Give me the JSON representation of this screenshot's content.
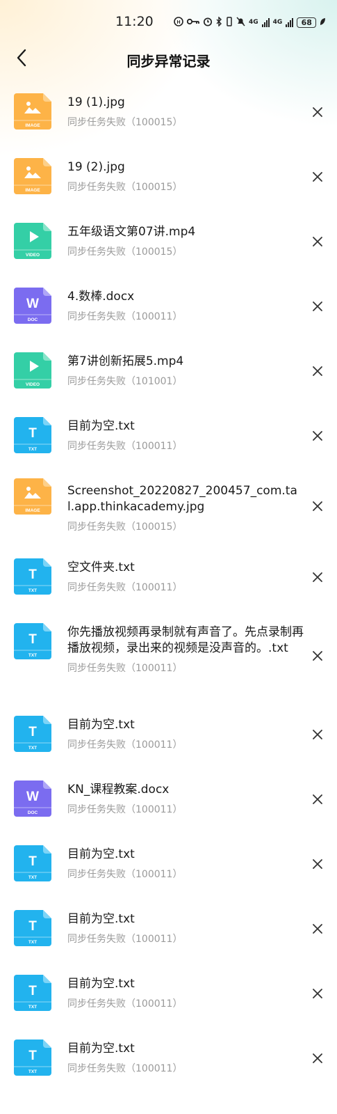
{
  "status_bar": {
    "time": "11:20",
    "net1": "4G",
    "net2": "4G",
    "battery": "68"
  },
  "header": {
    "title": "同步异常记录",
    "back_icon": "chevron-left-icon"
  },
  "icon_types": {
    "IMAGE": {
      "label": "IMAGE",
      "color": "#FDB347",
      "fold": "#FDD08A",
      "glyph": "image"
    },
    "VIDEO": {
      "label": "VIDEO",
      "color": "#34CFA6",
      "fold": "#86E4C9",
      "glyph": "play"
    },
    "DOC": {
      "label": "DOC",
      "color": "#7B6CF0",
      "fold": "#AFA6F7",
      "glyph": "W"
    },
    "TXT": {
      "label": "TXT",
      "color": "#22B3EE",
      "fold": "#7DD4F7",
      "glyph": "T"
    }
  },
  "items": [
    {
      "type": "IMAGE",
      "name": "19 (1).jpg",
      "status": "同步任务失败（100015）"
    },
    {
      "type": "IMAGE",
      "name": "19 (2).jpg",
      "status": "同步任务失败（100015）"
    },
    {
      "type": "VIDEO",
      "name": "五年级语文第07讲.mp4",
      "status": "同步任务失败（100015）"
    },
    {
      "type": "DOC",
      "name": "4.数棒.docx",
      "status": "同步任务失败（100011）"
    },
    {
      "type": "VIDEO",
      "name": "第7讲创新拓展5.mp4",
      "status": "同步任务失败（101001）"
    },
    {
      "type": "TXT",
      "name": "目前为空.txt",
      "status": "同步任务失败（100011）"
    },
    {
      "type": "IMAGE",
      "name": "Screenshot_20220827_200457_com.tal.app.thinkacademy.jpg",
      "status": "同步任务失败（100015）"
    },
    {
      "type": "TXT",
      "name": "空文件夹.txt",
      "status": "同步任务失败（100011）"
    },
    {
      "type": "TXT",
      "name": "你先播放视频再录制就有声音了。先点录制再播放视频，录出来的视频是没声音的。.txt",
      "status": "同步任务失败（100011）"
    },
    {
      "type": "TXT",
      "name": "目前为空.txt",
      "status": "同步任务失败（100011）"
    },
    {
      "type": "DOC",
      "name": "KN_课程教案.docx",
      "status": "同步任务失败（100011）"
    },
    {
      "type": "TXT",
      "name": "目前为空.txt",
      "status": "同步任务失败（100011）"
    },
    {
      "type": "TXT",
      "name": "目前为空.txt",
      "status": "同步任务失败（100011）"
    },
    {
      "type": "TXT",
      "name": "目前为空.txt",
      "status": "同步任务失败（100011）"
    },
    {
      "type": "TXT",
      "name": "目前为空.txt",
      "status": "同步任务失败（100011）"
    }
  ]
}
